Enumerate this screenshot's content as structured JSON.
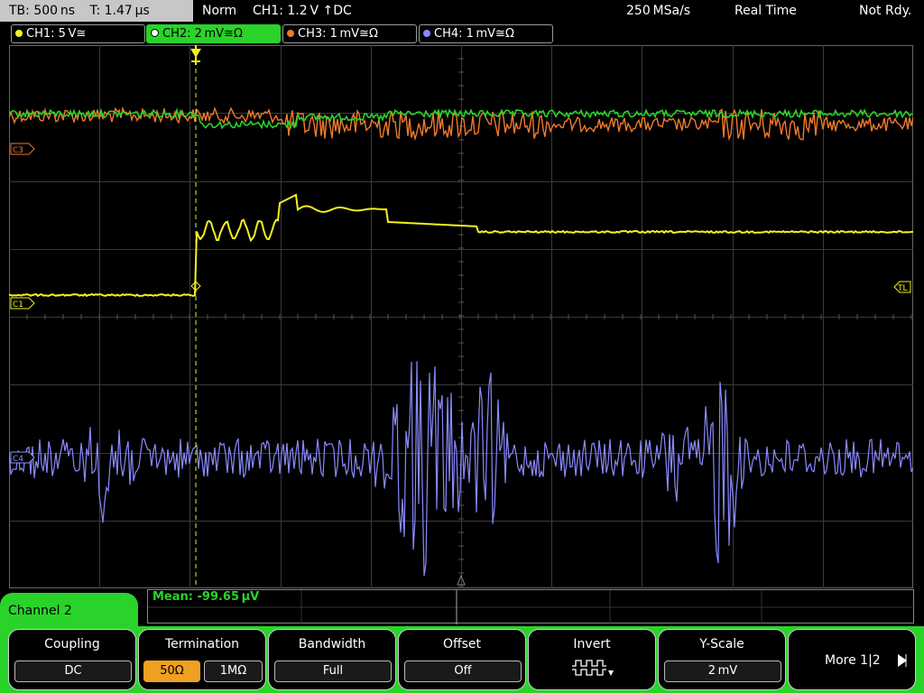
{
  "status_bar": {
    "timebase": "TB: 500 ns",
    "trigger_time": "T: 1.47 µs",
    "trigger_mode": "Norm",
    "trigger_info": "CH1: 1.2 V ↑DC",
    "sample_rate": "250 MSa/s",
    "acq_mode": "Real Time",
    "state": "Not Rdy."
  },
  "channels": [
    {
      "label": "CH1: 5 V≅",
      "color": "#f5f01e",
      "active": false
    },
    {
      "label": "CH2: 2 mV≅Ω",
      "color": "#2ad32a",
      "active": true
    },
    {
      "label": "CH3: 1 mV≅Ω",
      "color": "#f07a2a",
      "active": false
    },
    {
      "label": "CH4: 1 mV≅Ω",
      "color": "#8a8aff",
      "active": false
    }
  ],
  "markers": {
    "c3": "C3",
    "c1": "C1",
    "tl": "TL",
    "c4": "C4"
  },
  "measurement": {
    "mean": "Mean: -99.65 µV"
  },
  "panel": {
    "channel_label": "Channel 2"
  },
  "softkeys": {
    "coupling": {
      "title": "Coupling",
      "value": "DC"
    },
    "termination": {
      "title": "Termination",
      "options": [
        "50Ω",
        "1MΩ"
      ],
      "selected": "50Ω"
    },
    "bandwidth": {
      "title": "Bandwidth",
      "value": "Full"
    },
    "offset": {
      "title": "Offset",
      "value": "Off"
    },
    "invert": {
      "title": "Invert",
      "icon": "invert-waveform-icon"
    },
    "yscale": {
      "title": "Y-Scale",
      "value": "2 mV"
    },
    "more": {
      "label": "More 1|2",
      "icon": "triangle-right-icon"
    }
  }
}
